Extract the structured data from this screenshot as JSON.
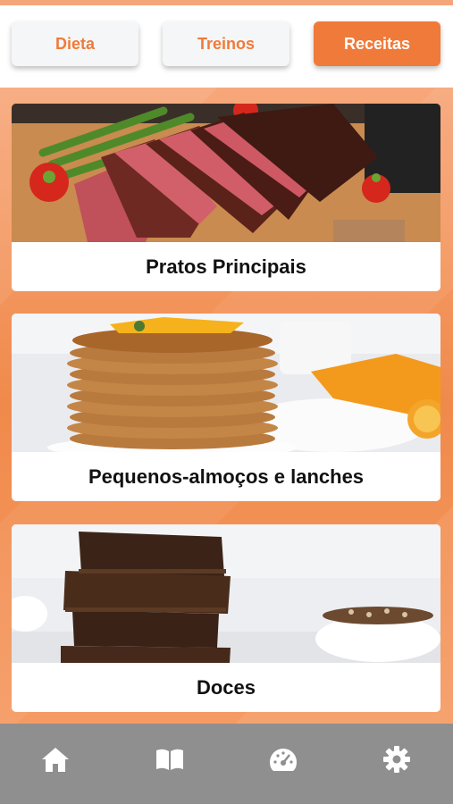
{
  "tabs": [
    {
      "label": "Dieta",
      "active": false
    },
    {
      "label": "Treinos",
      "active": false
    },
    {
      "label": "Receitas",
      "active": true
    }
  ],
  "categories": [
    {
      "label": "Pratos Principais",
      "image": "steak-with-asparagus-photo"
    },
    {
      "label": "Pequenos-almoços e lanches",
      "image": "pancake-stack-photo"
    },
    {
      "label": "Doces",
      "image": "brownies-photo"
    }
  ],
  "bottom_nav": [
    {
      "icon": "home-icon"
    },
    {
      "icon": "book-icon"
    },
    {
      "icon": "gauge-icon"
    },
    {
      "icon": "gear-icon"
    }
  ],
  "colors": {
    "accent": "#ef7a3a",
    "background": "#f08a4b",
    "nav_bar": "#8f8f8f"
  }
}
